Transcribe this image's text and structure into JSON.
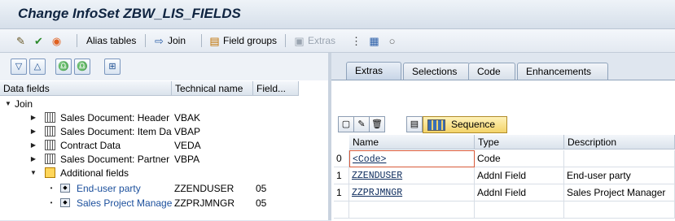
{
  "window": {
    "title": "Change InfoSet ZBW_LIS_FIELDS"
  },
  "toolbar": {
    "alias_tables": "Alias tables",
    "join": "Join",
    "field_groups": "Field groups",
    "extras": "Extras"
  },
  "left_grid": {
    "headers": [
      "Data fields",
      "Technical name",
      "Field..."
    ],
    "root": "Join",
    "nodes": [
      {
        "label": "Sales Document: Header",
        "tech": "VBAK"
      },
      {
        "label": "Sales Document: Item Da",
        "tech": "VBAP"
      },
      {
        "label": "Contract Data",
        "tech": "VEDA"
      },
      {
        "label": "Sales Document: Partner",
        "tech": "VBPA"
      }
    ],
    "additional": "Additional fields",
    "fields": [
      {
        "label": "End-user party",
        "tech": "ZZENDUSER",
        "group": "05"
      },
      {
        "label": "Sales Project Manager",
        "tech": "ZZPRJMNGR",
        "group": "05"
      }
    ]
  },
  "right": {
    "tabs": [
      "Extras",
      "Selections",
      "Code",
      "Enhancements"
    ],
    "sequence_label": "Sequence",
    "headers": [
      "Name",
      "Type",
      "Description"
    ],
    "rows": [
      {
        "idx": "0",
        "name": "<Code>",
        "type": "Code",
        "desc": ""
      },
      {
        "idx": "1",
        "name": "ZZENDUSER",
        "type": "Addnl Field",
        "desc": "End-user party"
      },
      {
        "idx": "1",
        "name": "ZZPRJMNGR",
        "type": "Addnl Field",
        "desc": "Sales Project Manager"
      }
    ]
  }
}
